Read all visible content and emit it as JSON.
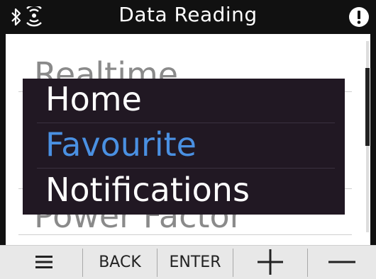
{
  "header": {
    "title": "Data Reading",
    "icons": [
      "bluetooth-icon",
      "wireless-icon",
      "alert-icon"
    ]
  },
  "list": {
    "items": [
      "Realtime",
      "Power Factor"
    ]
  },
  "popup_menu": {
    "items": [
      {
        "label": "Home",
        "selected": false
      },
      {
        "label": "Favourite",
        "selected": true
      },
      {
        "label": "Notifications",
        "selected": false
      }
    ]
  },
  "footer": {
    "menu_icon": "hamburger-icon",
    "back_label": "BACK",
    "enter_label": "ENTER",
    "plus_icon": "plus-icon",
    "minus_icon": "minus-icon"
  },
  "colors": {
    "header_bg": "#111111",
    "popup_bg": "#211823",
    "selected_text": "#4a90e2",
    "list_text": "#8a8a8a",
    "footer_bg": "#e8e8e8"
  }
}
